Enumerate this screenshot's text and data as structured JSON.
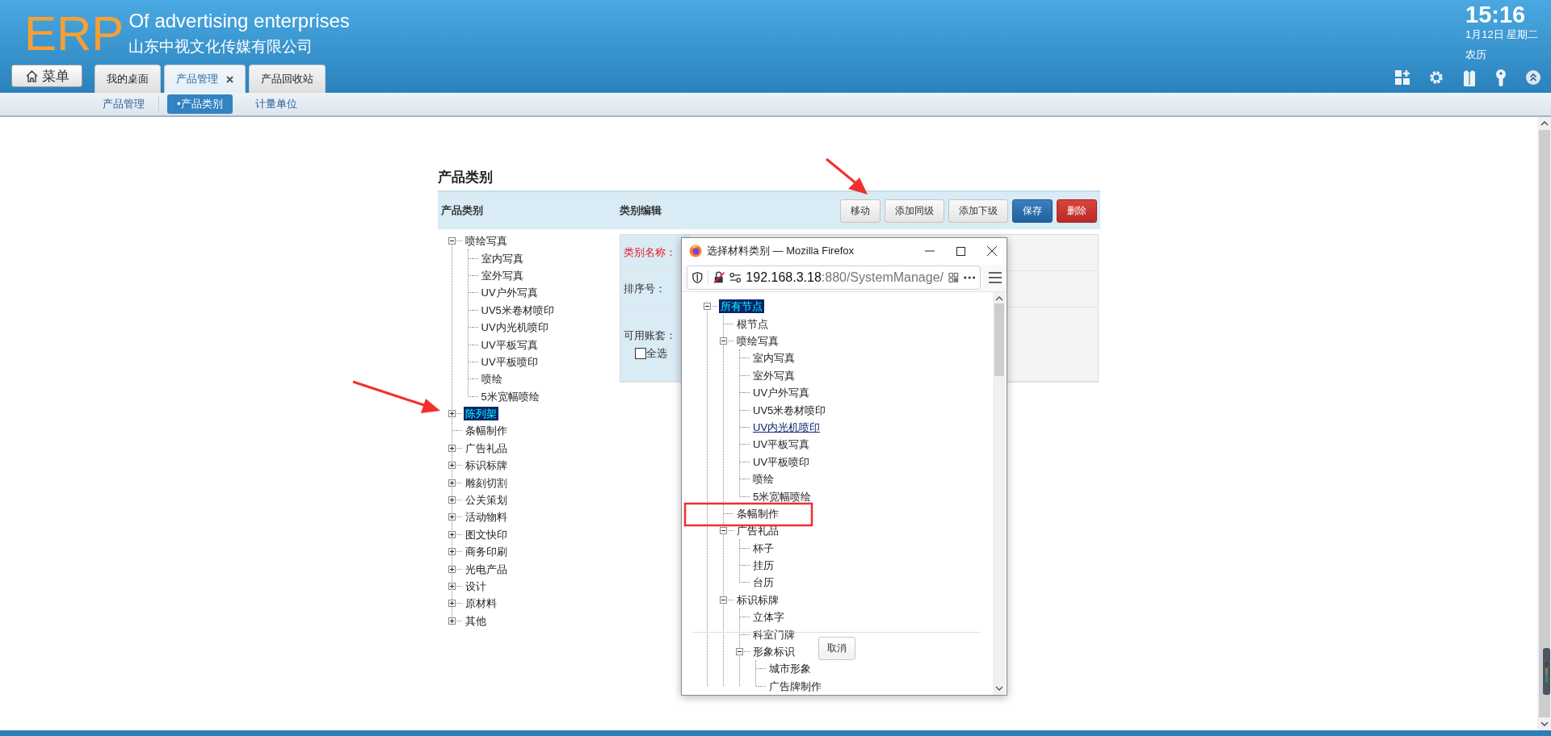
{
  "header": {
    "logo": "ERP",
    "title": "Of advertising enterprises",
    "company": "山东中视文化传媒有限公司",
    "menu_button": "菜单",
    "clock": {
      "time": "15:16",
      "date": "1月12日 星期二",
      "lunar": "农历"
    }
  },
  "tabs": [
    {
      "label": "我的桌面",
      "selected": false,
      "closable": false
    },
    {
      "label": "产品管理",
      "selected": true,
      "closable": true
    },
    {
      "label": "产品回收站",
      "selected": false,
      "closable": false
    }
  ],
  "subnav": [
    {
      "label": "产品管理",
      "selected": false
    },
    {
      "label": "•产品类别",
      "selected": true
    },
    {
      "label": "计量单位",
      "selected": false
    }
  ],
  "page": {
    "title": "产品类别",
    "left_header": "产品类别",
    "right_header": "类别编辑",
    "buttons": [
      {
        "label": "移动",
        "kind": "default"
      },
      {
        "label": "添加同级",
        "kind": "default"
      },
      {
        "label": "添加下级",
        "kind": "default"
      },
      {
        "label": "保存",
        "kind": "primary"
      },
      {
        "label": "删除",
        "kind": "danger"
      }
    ]
  },
  "tree": [
    {
      "label": "喷绘写真",
      "kind": "folder",
      "expanded": true,
      "selected": false,
      "children": [
        {
          "label": "室内写真",
          "kind": "leaf",
          "selected": false
        },
        {
          "label": "室外写真",
          "kind": "leaf",
          "selected": false
        },
        {
          "label": "UV户外写真",
          "kind": "leaf",
          "selected": false
        },
        {
          "label": "UV5米卷材喷印",
          "kind": "leaf",
          "selected": false
        },
        {
          "label": "UV内光机喷印",
          "kind": "leaf",
          "selected": false
        },
        {
          "label": "UV平板写真",
          "kind": "leaf",
          "selected": false
        },
        {
          "label": "UV平板喷印",
          "kind": "leaf",
          "selected": false
        },
        {
          "label": "喷绘",
          "kind": "leaf",
          "selected": false
        },
        {
          "label": "5米宽幅喷绘",
          "kind": "leaf",
          "selected": false
        }
      ]
    },
    {
      "label": "陈列架",
      "kind": "folder",
      "expanded": false,
      "selected": true
    },
    {
      "label": "条幅制作",
      "kind": "leaf",
      "selected": false
    },
    {
      "label": "广告礼品",
      "kind": "folder",
      "expanded": false,
      "selected": false
    },
    {
      "label": "标识标牌",
      "kind": "folder",
      "expanded": false,
      "selected": false
    },
    {
      "label": "雕刻切割",
      "kind": "folder",
      "expanded": false,
      "selected": false
    },
    {
      "label": "公关策划",
      "kind": "folder",
      "expanded": false,
      "selected": false
    },
    {
      "label": "活动物料",
      "kind": "folder",
      "expanded": false,
      "selected": false
    },
    {
      "label": "图文快印",
      "kind": "folder",
      "expanded": false,
      "selected": false
    },
    {
      "label": "商务印刷",
      "kind": "folder",
      "expanded": false,
      "selected": false
    },
    {
      "label": "光电产品",
      "kind": "folder",
      "expanded": false,
      "selected": false
    },
    {
      "label": "设计",
      "kind": "folder",
      "expanded": false,
      "selected": false
    },
    {
      "label": "原材料",
      "kind": "folder",
      "expanded": false,
      "selected": false
    },
    {
      "label": "其他",
      "kind": "folder",
      "expanded": false,
      "selected": false
    }
  ],
  "form": {
    "fields": [
      {
        "label": "类别名称：",
        "required": true
      },
      {
        "label": "排序号：",
        "required": false
      },
      {
        "label": "可用账套：",
        "required": false
      }
    ],
    "select_all": {
      "label": "全选",
      "checked": false
    }
  },
  "popup": {
    "title": "选择材料类别 — Mozilla Firefox",
    "url_host": "192.168.3.18",
    "url_path": ":880/SystemManage/",
    "cancel_button": "取消",
    "tree": [
      {
        "label": "所有节点",
        "kind": "folder",
        "expanded": true,
        "selected": true,
        "hovered": false,
        "children": [
          {
            "label": "根节点",
            "kind": "leaf",
            "selected": false,
            "hovered": false
          },
          {
            "label": "喷绘写真",
            "kind": "folder",
            "expanded": true,
            "selected": false,
            "hovered": false,
            "children": [
              {
                "label": "室内写真",
                "kind": "leaf",
                "selected": false,
                "hovered": false
              },
              {
                "label": "室外写真",
                "kind": "leaf",
                "selected": false,
                "hovered": false
              },
              {
                "label": "UV户外写真",
                "kind": "leaf",
                "selected": false,
                "hovered": false
              },
              {
                "label": "UV5米卷材喷印",
                "kind": "leaf",
                "selected": false,
                "hovered": false
              },
              {
                "label": "UV内光机喷印",
                "kind": "leaf",
                "selected": false,
                "hovered": true
              },
              {
                "label": "UV平板写真",
                "kind": "leaf",
                "selected": false,
                "hovered": false
              },
              {
                "label": "UV平板喷印",
                "kind": "leaf",
                "selected": false,
                "hovered": false
              },
              {
                "label": "喷绘",
                "kind": "leaf",
                "selected": false,
                "hovered": false
              },
              {
                "label": "5米宽幅喷绘",
                "kind": "leaf",
                "selected": false,
                "hovered": false
              }
            ]
          },
          {
            "label": "条幅制作",
            "kind": "leaf",
            "selected": false,
            "hovered": false
          },
          {
            "label": "广告礼品",
            "kind": "folder",
            "expanded": true,
            "selected": false,
            "hovered": false,
            "children": [
              {
                "label": "杯子",
                "kind": "leaf",
                "selected": false,
                "hovered": false
              },
              {
                "label": "挂历",
                "kind": "leaf",
                "selected": false,
                "hovered": false
              },
              {
                "label": "台历",
                "kind": "leaf",
                "selected": false,
                "hovered": false
              }
            ]
          },
          {
            "label": "标识标牌",
            "kind": "folder",
            "expanded": true,
            "selected": false,
            "hovered": false,
            "children": [
              {
                "label": "立体字",
                "kind": "leaf",
                "selected": false,
                "hovered": false
              },
              {
                "label": "科室门牌",
                "kind": "leaf",
                "selected": false,
                "hovered": false
              },
              {
                "label": "形象标识",
                "kind": "folder",
                "expanded": true,
                "selected": false,
                "hovered": false,
                "children": [
                  {
                    "label": "城市形象",
                    "kind": "leaf",
                    "selected": false,
                    "hovered": false
                  },
                  {
                    "label": "广告牌制作",
                    "kind": "leaf",
                    "selected": false,
                    "hovered": false
                  }
                ]
              }
            ]
          }
        ]
      }
    ]
  }
}
